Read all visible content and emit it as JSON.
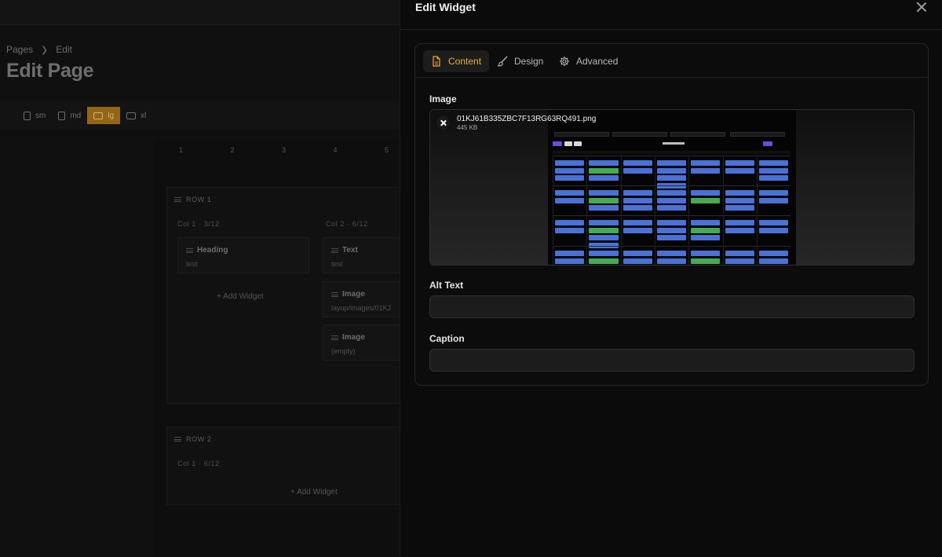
{
  "background": {
    "breadcrumb": {
      "root": "Pages",
      "current": "Edit"
    },
    "page_title": "Edit Page",
    "breakpoints": [
      {
        "label": "sm",
        "icon": "phone-icon",
        "active": false
      },
      {
        "label": "md",
        "icon": "tablet-icon",
        "active": false
      },
      {
        "label": "lg",
        "icon": "laptop-icon",
        "active": true
      },
      {
        "label": "xl",
        "icon": "monitor-icon",
        "active": false
      }
    ],
    "grid_numbers": [
      "1",
      "2",
      "3",
      "4",
      "5"
    ],
    "row1": {
      "label": "ROW 1",
      "col1": {
        "label": "Col 1 · 3/12",
        "widgets": [
          {
            "title": "Heading",
            "value": "test"
          }
        ],
        "add": "+ Add Widget"
      },
      "col2": {
        "label": "Col 2 · 6/12",
        "widgets": [
          {
            "title": "Text",
            "value": "test"
          },
          {
            "title": "Image",
            "value": "layup/images/01KJ"
          },
          {
            "title": "Image",
            "value": "(empty)"
          }
        ]
      }
    },
    "row2": {
      "label": "ROW 2",
      "col1": {
        "label": "Col 1 · 6/12",
        "add": "+ Add Widget"
      }
    }
  },
  "drawer": {
    "title": "Edit Widget",
    "tabs": [
      {
        "label": "Content",
        "icon": "document-icon",
        "active": true
      },
      {
        "label": "Design",
        "icon": "brush-icon",
        "active": false
      },
      {
        "label": "Advanced",
        "icon": "gear-icon",
        "active": false
      }
    ],
    "image": {
      "label": "Image",
      "file_name": "01KJ61B335ZBC7F13RG63RQ491.png",
      "file_size": "445 KB"
    },
    "alt_text": {
      "label": "Alt Text",
      "value": "",
      "placeholder": ""
    },
    "caption": {
      "label": "Caption",
      "value": "",
      "placeholder": ""
    }
  },
  "colors": {
    "accent": "#f0a93a",
    "breakpoint_active": "#946515",
    "event_blue": "#4f7be8",
    "event_green": "#4cba5a",
    "event_purple": "#6d4bd6"
  }
}
